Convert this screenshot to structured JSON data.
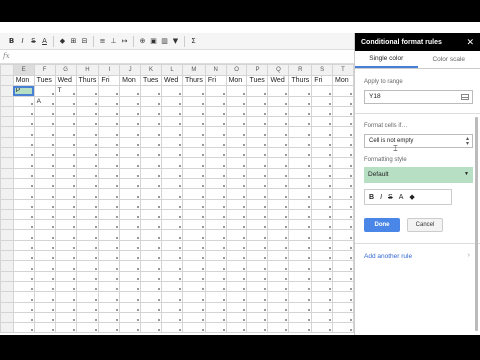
{
  "toolbar": {
    "items": [
      {
        "name": "bold-button",
        "label": "B"
      },
      {
        "name": "italic-button",
        "label": "I"
      },
      {
        "name": "strikethrough-button",
        "label": "S"
      },
      {
        "name": "text-color-button",
        "label": "A"
      },
      {
        "name": "fill-color-button",
        "label": "◆"
      },
      {
        "name": "borders-button",
        "label": "⊞"
      },
      {
        "name": "merge-button",
        "label": "⊟"
      },
      {
        "name": "align-button",
        "label": "≡"
      },
      {
        "name": "valign-button",
        "label": "⊥"
      },
      {
        "name": "wrap-button",
        "label": "↦"
      },
      {
        "name": "link-button",
        "label": "⊕"
      },
      {
        "name": "comment-button",
        "label": "▣"
      },
      {
        "name": "chart-button",
        "label": "▥"
      },
      {
        "name": "filter-button",
        "label": "▼"
      },
      {
        "name": "functions-button",
        "label": "Σ"
      }
    ]
  },
  "sheet": {
    "columns": [
      "E",
      "F",
      "G",
      "H",
      "I",
      "J",
      "K",
      "L",
      "M",
      "N",
      "O",
      "P",
      "Q",
      "R",
      "S",
      "T"
    ],
    "days": [
      "Mon",
      "Tues",
      "Wed",
      "Thurs",
      "Fri",
      "Mon",
      "Tues",
      "Wed",
      "Thurs",
      "Fri",
      "Mon",
      "Tues",
      "Wed",
      "Thurs",
      "Fri",
      "Mon"
    ],
    "row1": [
      "P",
      "",
      "T",
      "",
      "",
      "",
      "",
      "",
      "",
      "",
      "",
      "",
      "",
      "",
      "",
      ""
    ],
    "row2": [
      "",
      "A",
      "",
      "",
      "",
      "",
      "",
      "",
      "",
      "",
      "",
      "",
      "",
      "",
      "",
      ""
    ]
  },
  "panel": {
    "title": "Conditional format rules",
    "close": "✕",
    "tabs": [
      "Single color",
      "Color scale"
    ],
    "apply_label": "Apply to range",
    "range_value": "Y18",
    "format_if_label": "Format cells if…",
    "condition": "Cell is not empty",
    "formatting_label": "Formatting style",
    "style_value": "Default",
    "format_buttons": [
      "B",
      "I",
      "S",
      "A",
      "◆"
    ],
    "done": "Done",
    "cancel": "Cancel",
    "add_rule": "Add another rule",
    "add_arrow": "›"
  },
  "colors": {
    "accent": "#4a86e8",
    "highlight_green": "#b7dfc4",
    "header_bg": "#000000"
  }
}
